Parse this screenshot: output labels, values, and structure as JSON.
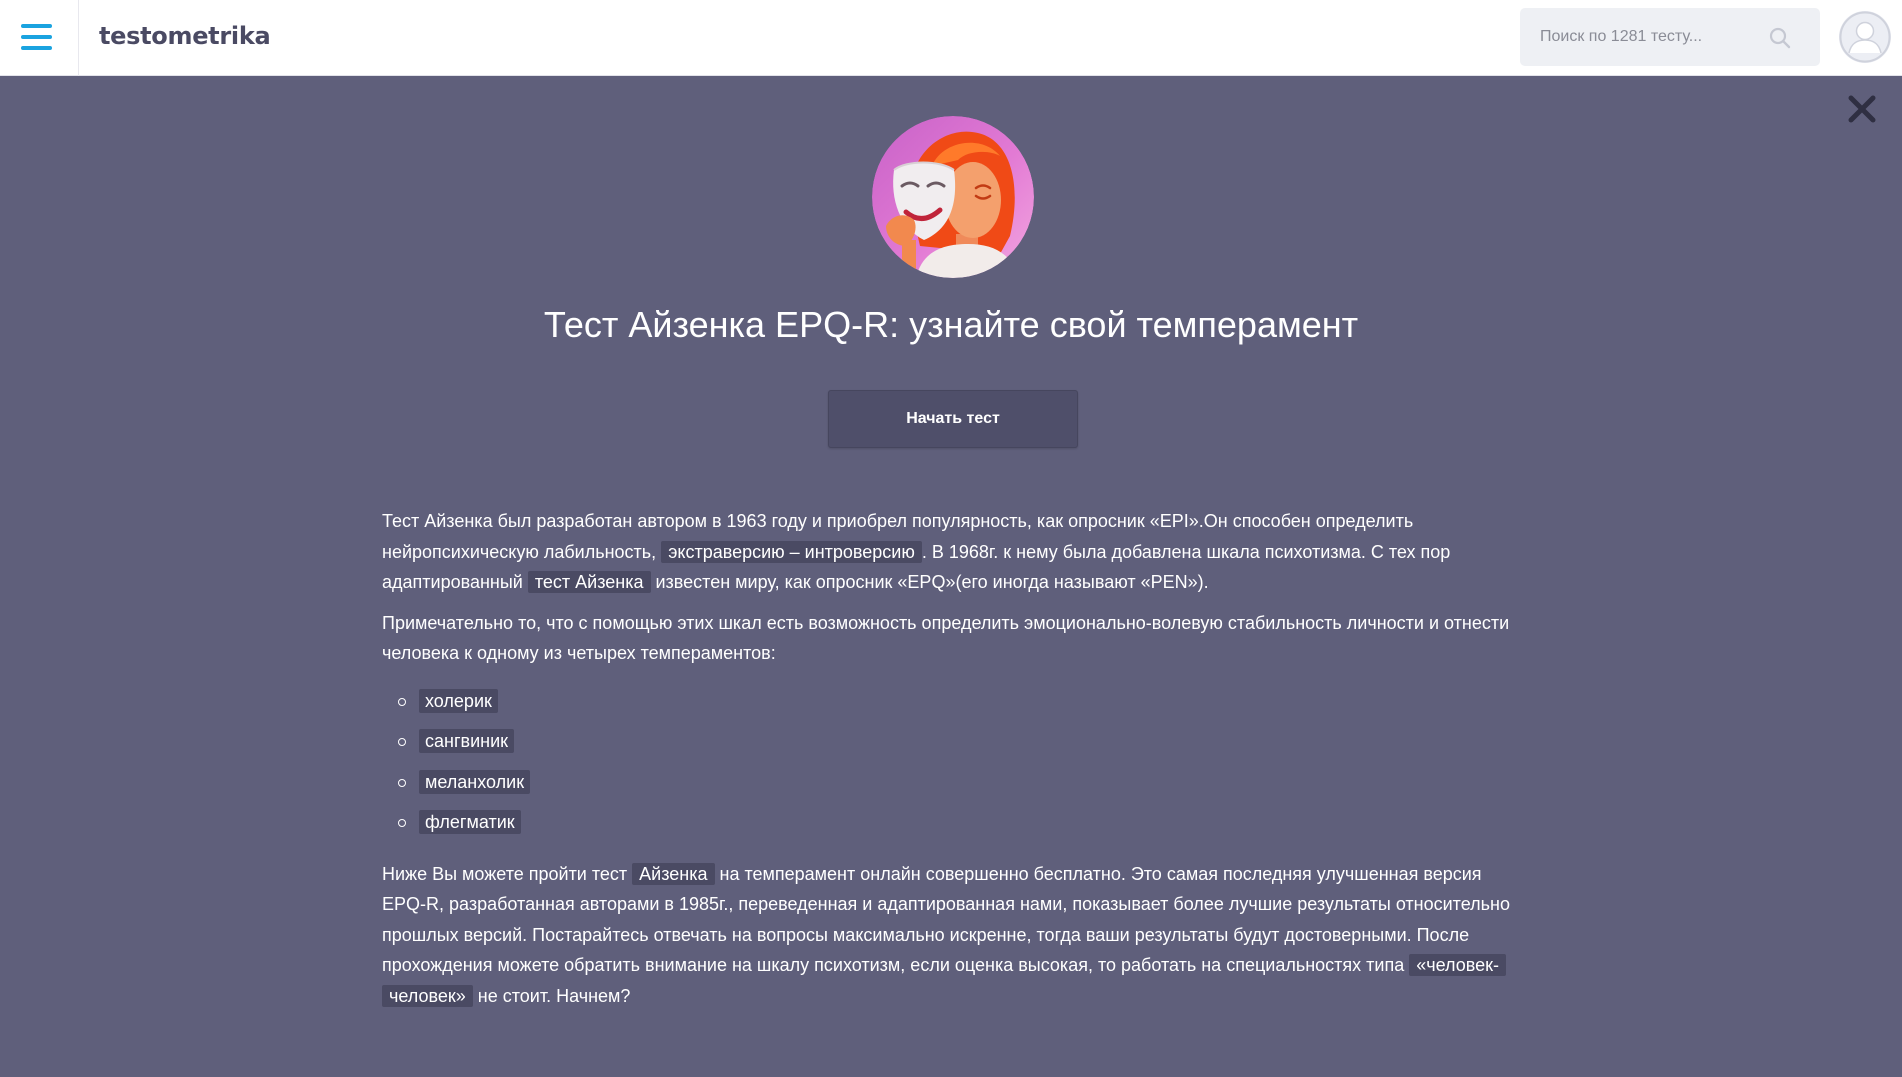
{
  "header": {
    "logo": "testometrika",
    "search_placeholder": "Поиск по 1281 тесту...",
    "search_value": "",
    "menu_icon": "hamburger-menu-icon",
    "search_icon": "search-icon",
    "avatar_icon": "user-avatar-icon",
    "accent_color": "#1aa3e0"
  },
  "modal": {
    "close_icon": "close-icon",
    "image": "theatre-mask-illustration",
    "title": "Тест Айзенка EPQ-R: узнайте свой темперамент",
    "start_button": "Начать тест",
    "background_color": "#5f5f7b"
  },
  "description": {
    "p1": {
      "t1": "Тест Айзенка был разработан автором в 1963 году и приобрел популярность, как опросник «EPI».Он способен определить нейропсихическую лабильность, ",
      "h1": "экстраверсию – интроверсию",
      "t2": ". В 1968г. к нему была добавлена шкала психотизма. С тех пор адаптированный ",
      "h2": "тест Айзенка",
      "t3": " известен миру, как опросник «EPQ»(его иногда называют «PEN»)."
    },
    "p2": "Примечательно то, что с помощью этих шкал есть возможность определить эмоционально-волевую стабильность личности и отнести человека к одному из четырех темпераментов:",
    "temperaments": [
      "холерик",
      "сангвиник",
      "меланхолик",
      "флегматик"
    ],
    "p3": {
      "t1": "Ниже Вы можете пройти тест ",
      "h1": "Айзенка",
      "t2": " на темперамент онлайн совершенно бесплатно. Это самая последняя улучшенная версия EPQ-R, разработанная авторами в 1985г., переведенная и адаптированная нами, показывает более лучшие результаты относительно прошлых версий. Постарайтесь отвечать на вопросы максимально искренне, тогда ваши результаты будут достоверными. После прохождения можете обратить внимание на шкалу психотизм, если оценка высокая, то работать на специальностях типа ",
      "h2": "«человек-человек»",
      "t3": " не стоит. Начнем?"
    }
  }
}
